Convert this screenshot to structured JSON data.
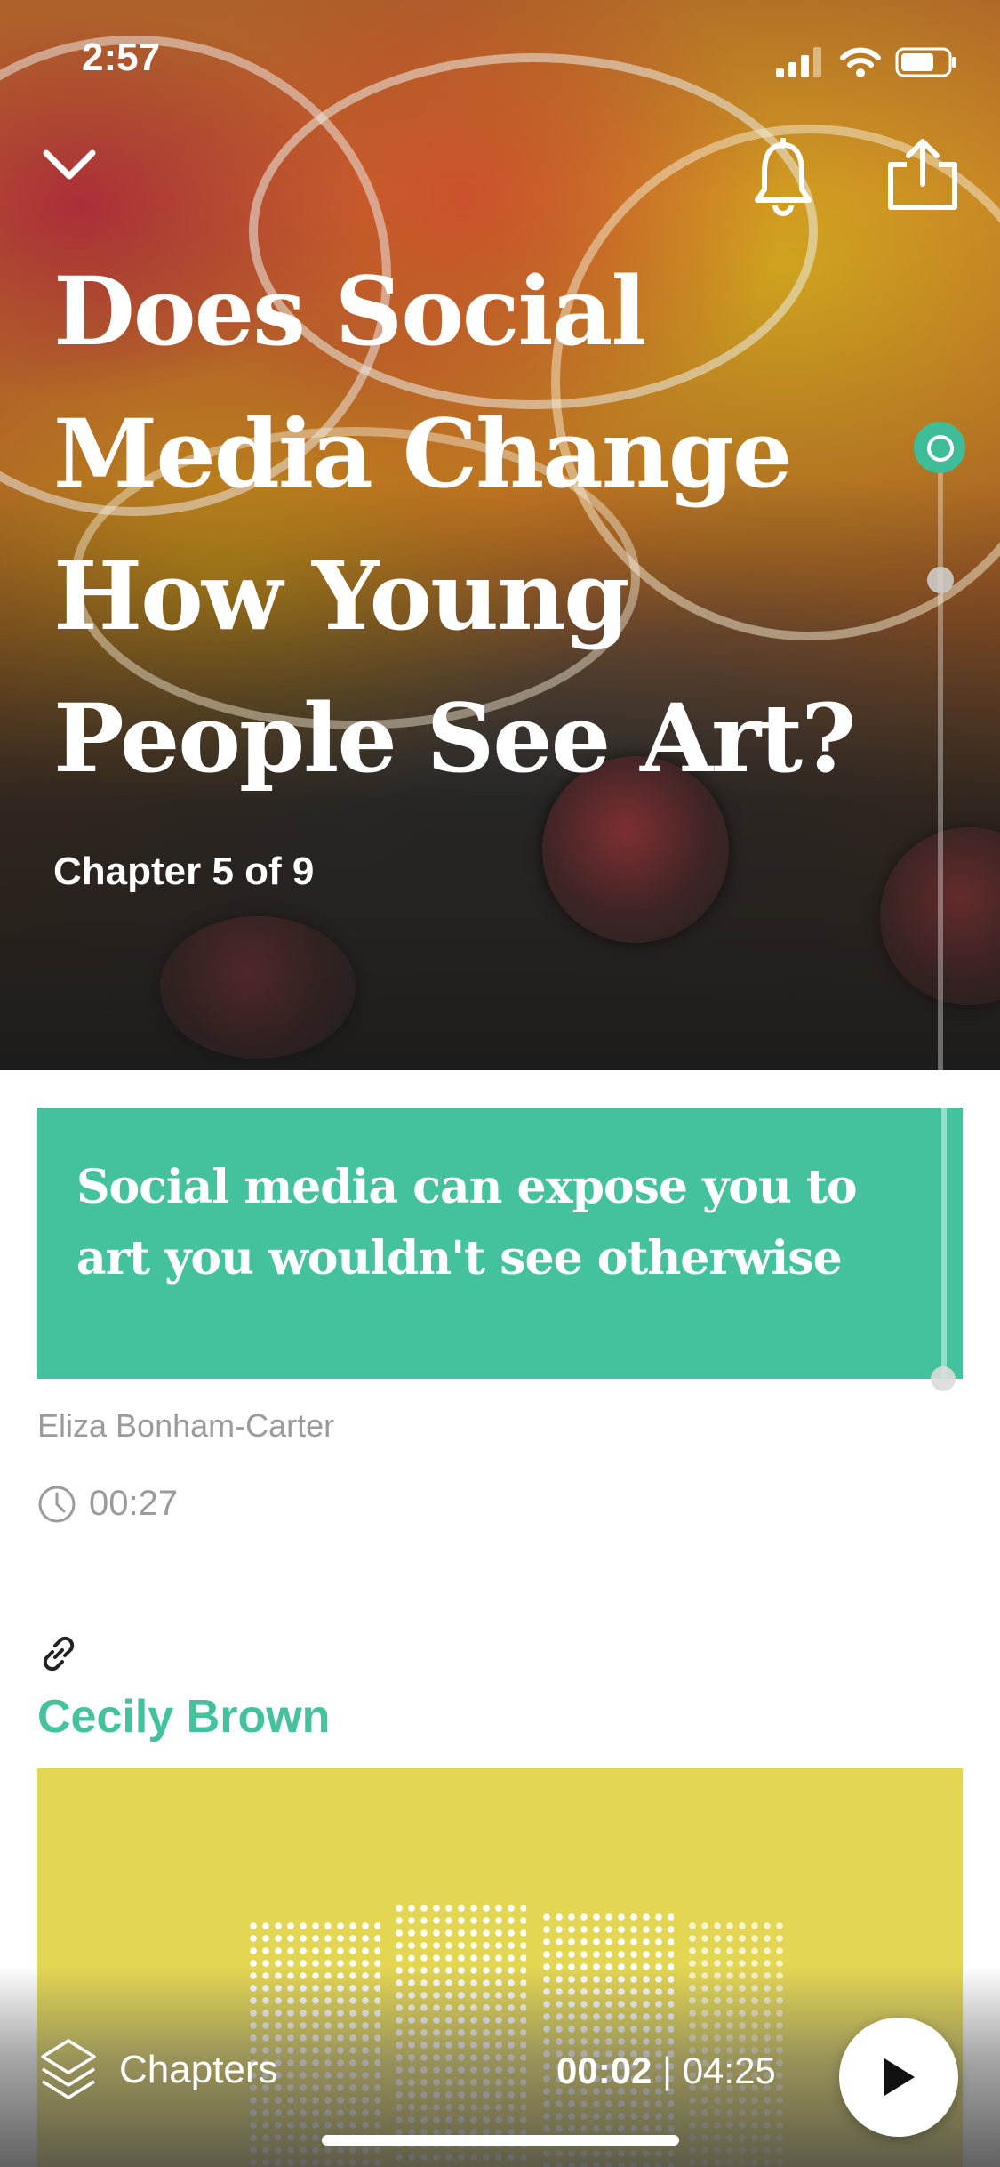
{
  "status_bar": {
    "time": "2:57"
  },
  "hero": {
    "title": "Does Social Media Change How Young People See Art?",
    "chapter_info": "Chapter 5 of 9"
  },
  "icons": {
    "collapse": "chevron-down-icon",
    "notify": "bell-icon",
    "share": "share-icon",
    "duration": "clock-icon",
    "link": "link-icon",
    "chapters": "layers-icon",
    "play": "play-icon"
  },
  "quote": {
    "text": "Social media can expose you to art you wouldn't see otherwise",
    "author": "Eliza Bonham-Carter",
    "duration": "00:27"
  },
  "related": {
    "name": "Cecily Brown"
  },
  "player": {
    "chapters_label": "Chapters",
    "current_time": "00:02",
    "separator": "|",
    "total_time": "04:25"
  },
  "colors": {
    "accent": "#44c19d",
    "image_yellow": "#e3d653"
  }
}
